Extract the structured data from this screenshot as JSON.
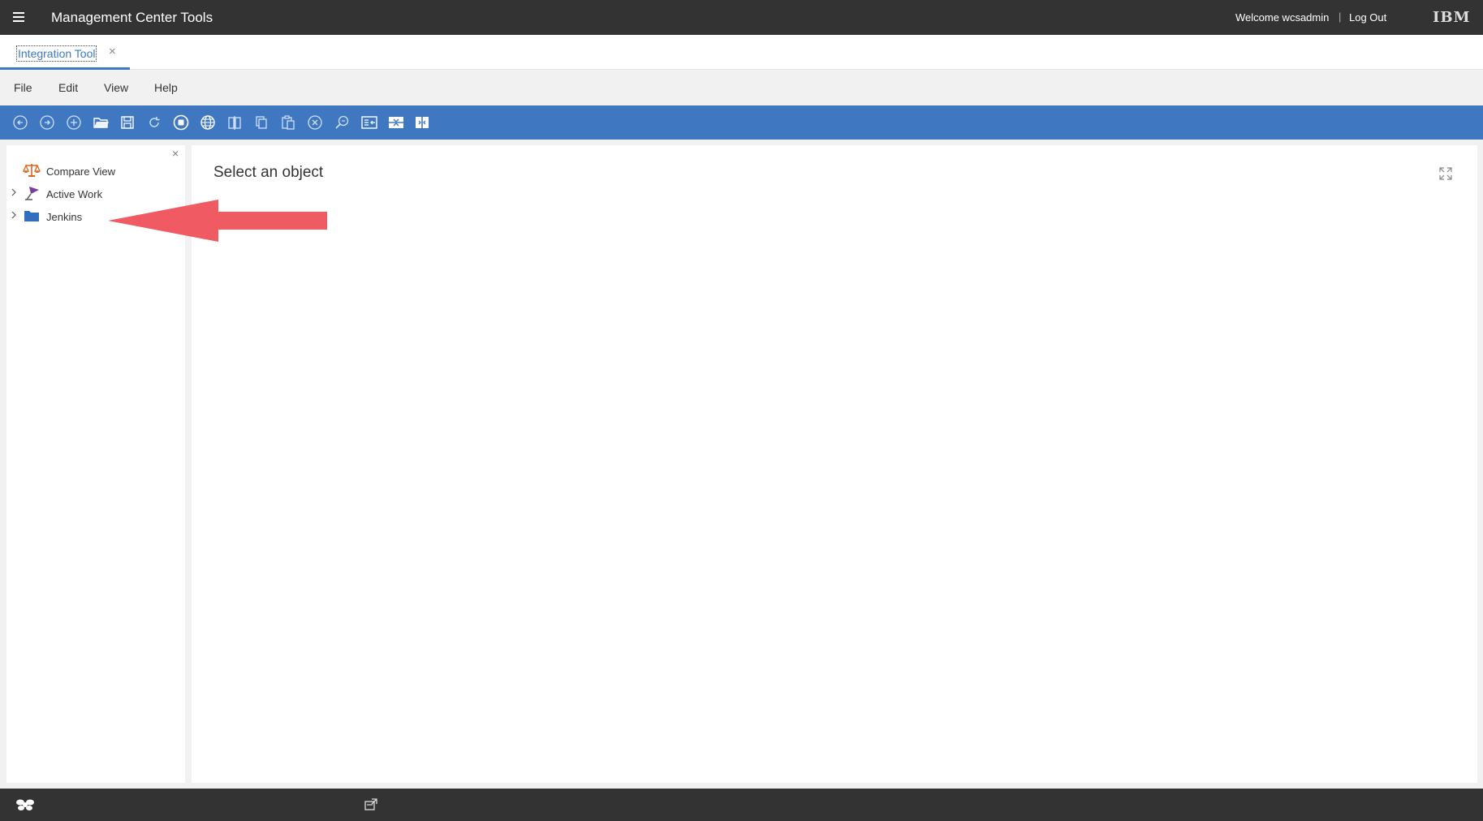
{
  "header": {
    "title": "Management Center Tools",
    "welcome": "Welcome wcsadmin",
    "separator": "|",
    "logout": "Log Out",
    "logo": "IBM"
  },
  "tabs": [
    {
      "label": "Integration Tool",
      "close": "×"
    }
  ],
  "menu": [
    "File",
    "Edit",
    "View",
    "Help"
  ],
  "toolbar": {
    "icons": [
      "back-icon",
      "forward-icon",
      "new-icon",
      "open-icon",
      "save-icon",
      "refresh-icon",
      "stop-icon",
      "globe-icon",
      "compare-icon",
      "copy-icon",
      "paste-icon",
      "delete-icon",
      "find-icon",
      "import-icon",
      "merge-icon",
      "split-icon"
    ],
    "background": "#3f78c1"
  },
  "explorer": {
    "close": "×",
    "items": [
      {
        "label": "Compare View",
        "icon": "scales-icon",
        "expandable": false
      },
      {
        "label": "Active Work",
        "icon": "workspace-icon",
        "expandable": true
      },
      {
        "label": "Jenkins",
        "icon": "folder-icon",
        "expandable": true
      }
    ]
  },
  "main": {
    "title": "Select an object"
  },
  "annotation": {
    "color": "#f05a63",
    "points_to": "Jenkins"
  }
}
